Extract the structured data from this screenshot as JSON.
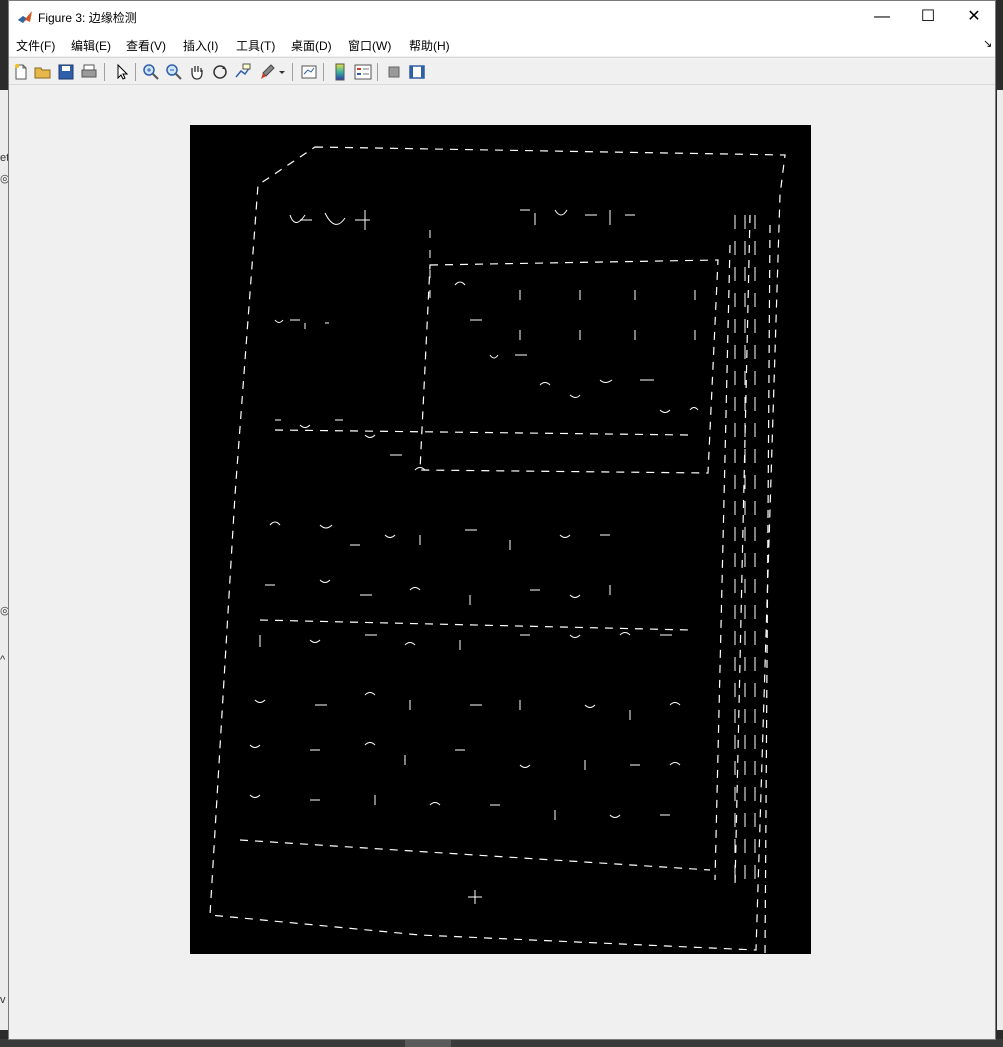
{
  "window": {
    "title": "Figure 3: 边缘检测",
    "controls": {
      "minimize": "—",
      "maximize": "☐",
      "close": "✕"
    }
  },
  "menubar": {
    "items": [
      {
        "label": "文件(F)"
      },
      {
        "label": "编辑(E)"
      },
      {
        "label": "查看(V)"
      },
      {
        "label": "插入(I)"
      },
      {
        "label": "工具(T)"
      },
      {
        "label": "桌面(D)"
      },
      {
        "label": "窗口(W)"
      },
      {
        "label": "帮助(H)"
      }
    ],
    "overflow_arrow": "↘"
  },
  "toolbar": {
    "buttons": [
      "new-figure-icon",
      "open-folder-icon",
      "save-icon",
      "print-icon",
      "pointer-icon",
      "zoom-in-icon",
      "zoom-out-icon",
      "pan-hand-icon",
      "rotate-3d-icon",
      "data-cursor-icon",
      "brush-icon",
      "dropdown-arrow-icon",
      "link-plot-icon",
      "colorbar-icon",
      "legend-icon",
      "hide-plot-tools-icon",
      "show-plot-tools-icon"
    ]
  },
  "figure": {
    "description_image": "edge-detection-output",
    "background": "#000000",
    "foreground": "#ffffff"
  },
  "colors": {
    "window_bg": "#f0f0f0",
    "titlebar_bg": "#ffffff",
    "canvas_bg": "#000000",
    "edge_color": "#ffffff"
  }
}
